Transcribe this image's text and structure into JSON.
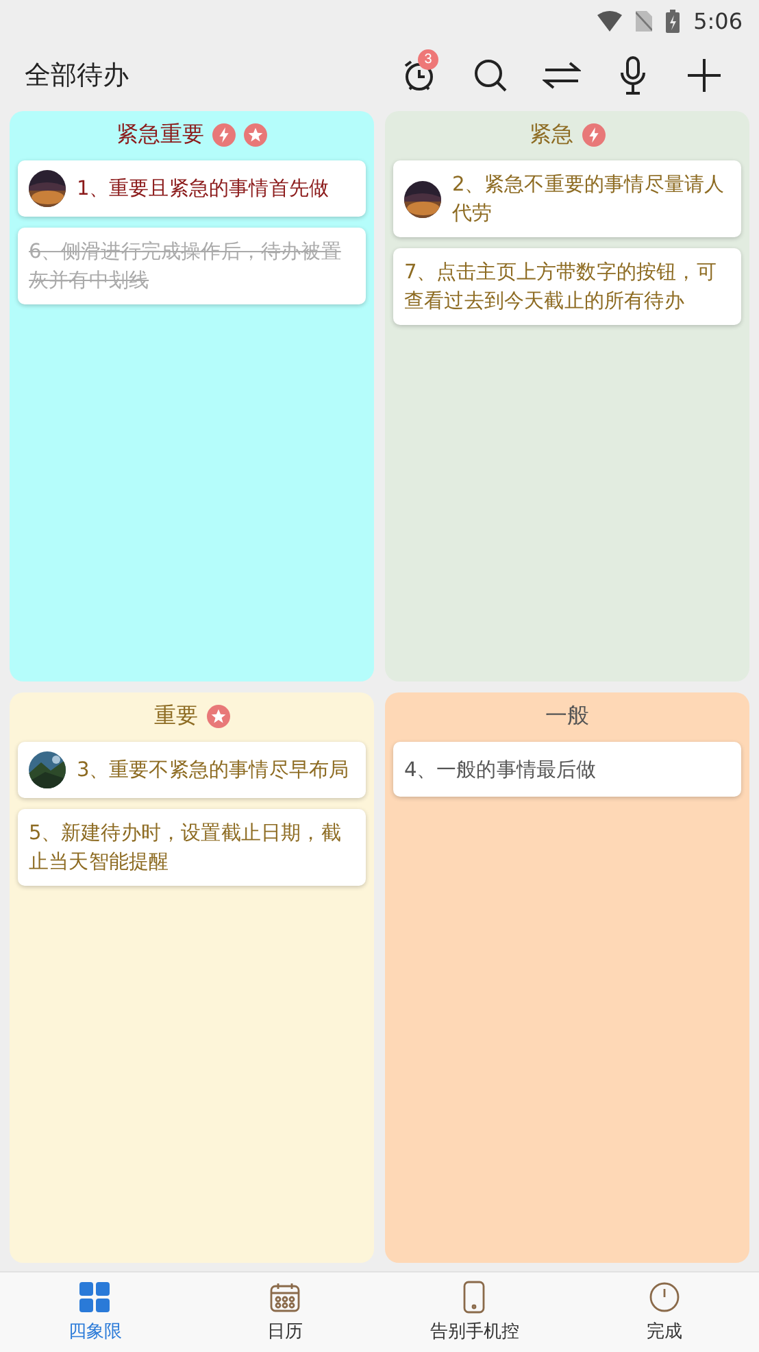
{
  "status_bar": {
    "time": "5:06"
  },
  "header": {
    "title": "全部待办",
    "alarm_badge": "3"
  },
  "quadrants": [
    {
      "title": "紧急重要",
      "urgent": true,
      "important": true,
      "color": "#8b1a1a",
      "tasks": [
        {
          "text": "1、重要且紧急的事情首先做",
          "done": false
        },
        {
          "text": "6、侧滑进行完成操作后，待办被置灰并有中划线",
          "done": true
        }
      ]
    },
    {
      "title": "紧急",
      "urgent": true,
      "important": false,
      "color": "#8d6b22",
      "tasks": [
        {
          "text": "2、紧急不重要的事情尽量请人代劳",
          "done": false
        },
        {
          "text": "7、点击主页上方带数字的按钮，可查看过去到今天截止的所有待办",
          "done": false
        }
      ]
    },
    {
      "title": "重要",
      "urgent": false,
      "important": true,
      "color": "#8d6b22",
      "tasks": [
        {
          "text": "3、重要不紧急的事情尽早布局",
          "done": false
        },
        {
          "text": "5、新建待办时，设置截止日期，截止当天智能提醒",
          "done": false
        }
      ]
    },
    {
      "title": "一般",
      "urgent": false,
      "important": false,
      "color": "#555555",
      "tasks": [
        {
          "text": "4、一般的事情最后做",
          "done": false
        }
      ]
    }
  ],
  "tabs": [
    {
      "label": "四象限",
      "kind": "grid",
      "selected": true
    },
    {
      "label": "日历",
      "kind": "calendar",
      "selected": false
    },
    {
      "label": "告别手机控",
      "kind": "phone",
      "selected": false
    },
    {
      "label": "完成",
      "kind": "clock",
      "selected": false
    }
  ]
}
